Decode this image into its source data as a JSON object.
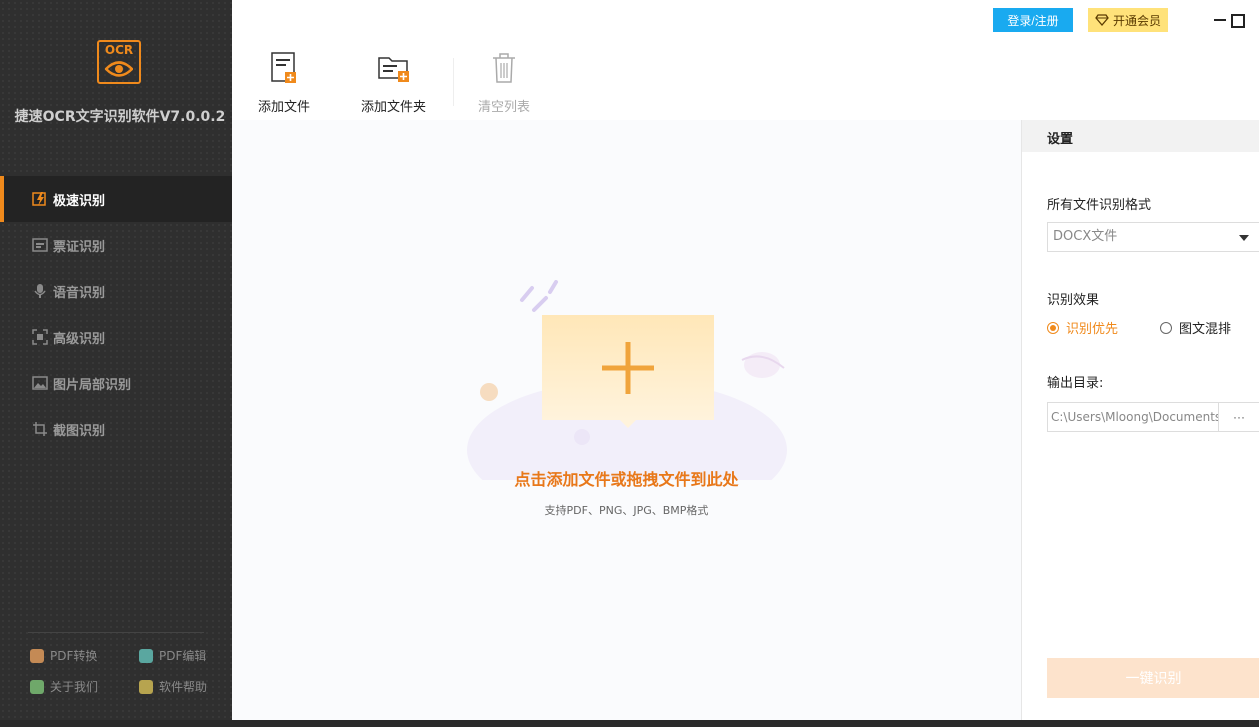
{
  "app": {
    "title": "捷速OCR文字识别软件V7.0.0.2",
    "logo_text": "OCR"
  },
  "sidebar": {
    "items": [
      {
        "label": "极速识别",
        "icon": "lightning-icon"
      },
      {
        "label": "票证识别",
        "icon": "ticket-icon"
      },
      {
        "label": "语音识别",
        "icon": "microphone-icon"
      },
      {
        "label": "高级识别",
        "icon": "scan-frame-icon"
      },
      {
        "label": "图片局部识别",
        "icon": "image-icon"
      },
      {
        "label": "截图识别",
        "icon": "screenshot-icon"
      }
    ],
    "footer": {
      "pdf_convert": "PDF转换",
      "pdf_edit": "PDF编辑",
      "about": "关于我们",
      "help": "软件帮助"
    }
  },
  "topbar": {
    "login": "登录/注册",
    "vip": "开通会员"
  },
  "toolbar": {
    "add_file": "添加文件",
    "add_folder": "添加文件夹",
    "clear_list": "清空列表"
  },
  "dropzone": {
    "title": "点击添加文件或拖拽文件到此处",
    "subtitle": "支持PDF、PNG、JPG、BMP格式"
  },
  "settings": {
    "header": "设置",
    "format_label": "所有文件识别格式",
    "format_value": "DOCX文件",
    "effect_label": "识别效果",
    "effect_options": [
      "识别优先",
      "图文混排"
    ],
    "output_label": "输出目录:",
    "output_path": "C:\\Users\\Mloong\\Documents",
    "browse": "···",
    "start": "一键识别"
  },
  "colors": {
    "accent": "#f08a1c",
    "login_blue": "#19aaf0",
    "vip_yellow": "#ffe27a",
    "sidebar_bg": "#2f2f2f"
  }
}
